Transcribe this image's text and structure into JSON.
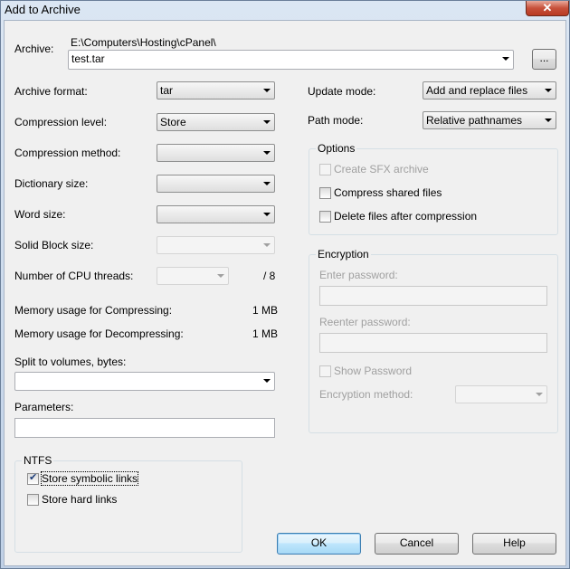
{
  "window": {
    "title": "Add to Archive",
    "close_glyph": "✕"
  },
  "archive": {
    "label": "Archive:",
    "path": "E:\\Computers\\Hosting\\cPanel\\",
    "value": "test.tar",
    "browse_label": "..."
  },
  "left": {
    "archive_format": {
      "label": "Archive format:",
      "value": "tar"
    },
    "compression_level": {
      "label": "Compression level:",
      "value": "Store"
    },
    "compression_method": {
      "label": "Compression method:",
      "value": ""
    },
    "dictionary_size": {
      "label": "Dictionary size:",
      "value": ""
    },
    "word_size": {
      "label": "Word size:",
      "value": ""
    },
    "solid_block_size": {
      "label": "Solid Block size:",
      "value": ""
    },
    "cpu_threads": {
      "label": "Number of CPU threads:",
      "value": "",
      "max": "/ 8"
    },
    "mem_compress": {
      "label": "Memory usage for Compressing:",
      "value": "1 MB"
    },
    "mem_decompress": {
      "label": "Memory usage for Decompressing:",
      "value": "1 MB"
    },
    "split": {
      "label": "Split to volumes, bytes:",
      "value": ""
    },
    "parameters": {
      "label": "Parameters:",
      "value": ""
    }
  },
  "ntfs": {
    "title": "NTFS",
    "store_symbolic_links": {
      "label": "Store symbolic links",
      "checked": true
    },
    "store_hard_links": {
      "label": "Store hard links",
      "checked": false
    }
  },
  "right": {
    "update_mode": {
      "label": "Update mode:",
      "value": "Add and replace files"
    },
    "path_mode": {
      "label": "Path mode:",
      "value": "Relative pathnames"
    }
  },
  "options": {
    "title": "Options",
    "create_sfx": {
      "label": "Create SFX archive",
      "checked": false,
      "enabled": false
    },
    "compress_shared": {
      "label": "Compress shared files",
      "checked": false
    },
    "delete_after": {
      "label": "Delete files after compression",
      "checked": false
    }
  },
  "encryption": {
    "title": "Encryption",
    "enter_password_label": "Enter password:",
    "reenter_password_label": "Reenter password:",
    "show_password_label": "Show Password",
    "method_label": "Encryption method:",
    "method_value": ""
  },
  "buttons": {
    "ok": "OK",
    "cancel": "Cancel",
    "help": "Help"
  }
}
